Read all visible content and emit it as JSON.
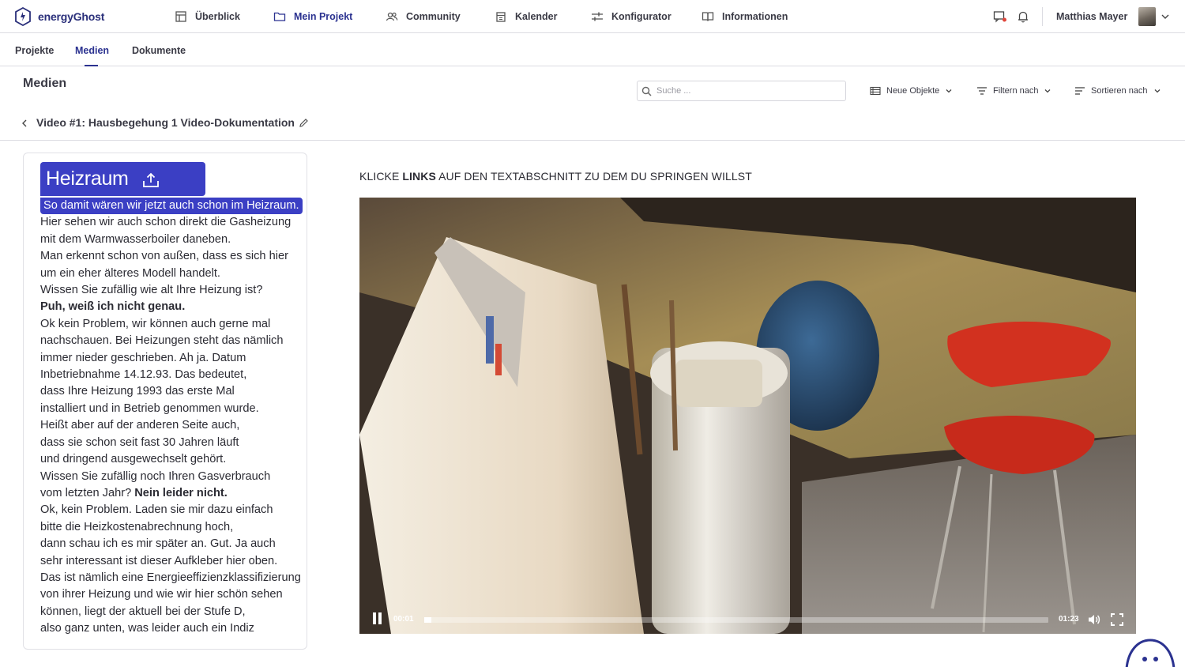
{
  "app": {
    "logo_text_light": "energy",
    "logo_text_bold": "Ghost"
  },
  "nav": {
    "items": [
      {
        "label": "Überblick",
        "icon": "grid-icon"
      },
      {
        "label": "Mein Projekt",
        "icon": "folder-icon",
        "active": true
      },
      {
        "label": "Community",
        "icon": "users-icon"
      },
      {
        "label": "Kalender",
        "icon": "calendar-icon"
      },
      {
        "label": "Konfigurator",
        "icon": "sliders-icon"
      },
      {
        "label": "Informationen",
        "icon": "book-icon"
      }
    ],
    "user_name": "Matthias Mayer"
  },
  "subnav": {
    "tabs": [
      "Projekte",
      "Medien",
      "Dokumente"
    ],
    "active": "Medien"
  },
  "toolbar": {
    "page_title": "Medien",
    "search_placeholder": "Suche ...",
    "new_objects": "Neue Objekte",
    "filter": "Filtern nach",
    "sort": "Sortieren nach"
  },
  "video_title": "Video #1: Hausbegehung 1 Video-Dokumentation",
  "transcript": {
    "section": "Heizraum",
    "highlighted": "So damit wären wir jetzt auch schon im Heizraum.",
    "lines": [
      "Hier sehen wir auch schon direkt die Gasheizung",
      "mit dem Warmwasserboiler daneben.",
      "Man erkennt schon von außen, dass es sich hier",
      "um ein eher älteres Modell handelt.",
      "Wissen Sie zufällig wie alt Ihre Heizung ist?"
    ],
    "answer_1": "Puh, weiß ich nicht genau.",
    "lines_2": [
      "Ok kein Problem, wir können auch gerne mal",
      "nachschauen. Bei Heizungen steht das nämlich",
      "immer nieder geschrieben. Ah ja. Datum",
      "Inbetriebnahme 14.12.93. Das bedeutet,",
      "dass Ihre Heizung 1993 das erste Mal",
      "installiert und in Betrieb genommen wurde.",
      "Heißt aber auf der anderen Seite auch,",
      "dass sie schon seit fast 30 Jahren läuft",
      "und dringend ausgewechselt gehört.",
      "Wissen Sie zufällig noch Ihren Gasverbrauch"
    ],
    "mixed_prefix": "vom letzten Jahr?",
    "answer_2": "Nein leider nicht.",
    "lines_3": [
      "Ok, kein Problem. Laden sie mir dazu einfach",
      "bitte die Heizkostenabrechnung hoch,",
      "dann schau ich es mir später an. Gut. Ja auch",
      "sehr interessant ist dieser Aufkleber hier oben.",
      "Das ist nämlich eine Energieeffizienzklassifizierung",
      "von ihrer Heizung und wie wir hier schön sehen",
      "können, liegt der aktuell bei der Stufe D,",
      "also ganz unten, was leider auch ein Indiz"
    ]
  },
  "instruction": {
    "pre": "KLICKE ",
    "bold": "LINKS",
    "post": " AUF DEN TEXTABSCHNITT ZU DEM DU SPRINGEN WILLST"
  },
  "player": {
    "current": "00:01",
    "duration": "01:23",
    "progress": 0.012
  },
  "colors": {
    "accent": "#3b3fc4",
    "nav_active": "#2b3290"
  }
}
